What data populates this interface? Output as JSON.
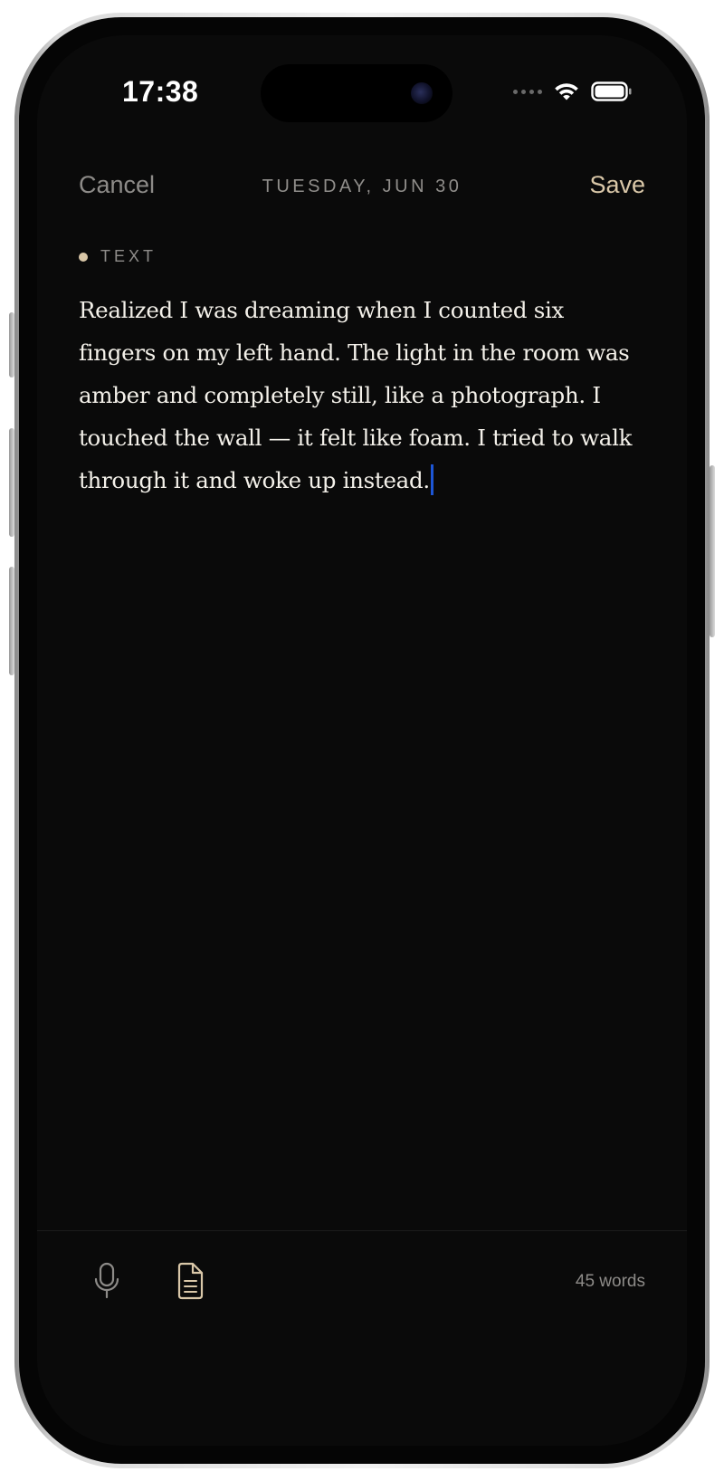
{
  "status_bar": {
    "time": "17:38",
    "icons": [
      "cellular-signal-icon",
      "wifi-icon",
      "battery-icon"
    ]
  },
  "nav": {
    "cancel_label": "Cancel",
    "date_label": "TUESDAY, JUN 30",
    "save_label": "Save"
  },
  "entry": {
    "type_label": "TEXT",
    "body": "Realized I was dreaming when I counted six fingers on my left hand. The light in the room was amber and completely still, like a photograph. I touched the wall — it felt like foam. I tried to walk through it and woke up instead."
  },
  "toolbar": {
    "icons": [
      "microphone-icon",
      "document-icon"
    ],
    "word_count": "45 words"
  },
  "colors": {
    "background": "#0a0a0a",
    "accent": "#d9c7a8",
    "muted_text": "#8d8b88",
    "body_text": "#f4f1ea",
    "caret": "#1d56d6"
  }
}
